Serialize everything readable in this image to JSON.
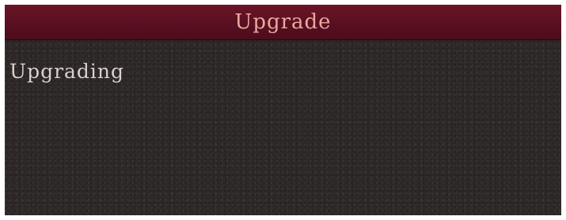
{
  "window": {
    "title": "Upgrade"
  },
  "content": {
    "status_text": "Upgrading"
  },
  "colors": {
    "titlebar": "#5a0f20",
    "background": "#2e2828",
    "title_text": "#e7a9a0",
    "body_text": "#d8d0cc"
  }
}
